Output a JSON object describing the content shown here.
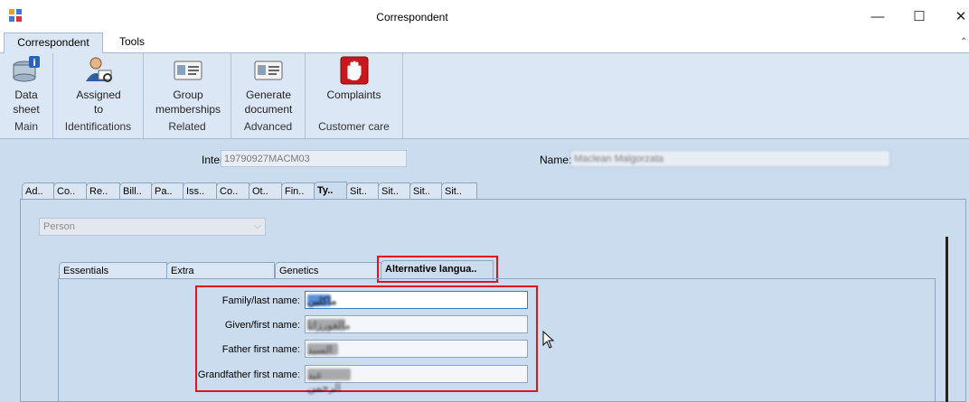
{
  "window": {
    "title": "Correspondent",
    "minimize_glyph": "—",
    "maximize_glyph": "☐",
    "close_glyph": "✕",
    "collapse_glyph": "⌃"
  },
  "ribbon": {
    "tabs": [
      {
        "label": "Correspondent",
        "selected": true
      },
      {
        "label": "Tools",
        "selected": false
      }
    ],
    "groups": [
      {
        "caption": "Main",
        "buttons": [
          {
            "label_lines": [
              "Data",
              "sheet"
            ],
            "icon": "database-info-icon"
          }
        ]
      },
      {
        "caption": "Identifications",
        "buttons": [
          {
            "label_lines": [
              "Assigned",
              "to"
            ],
            "icon": "person-id-search-icon"
          }
        ]
      },
      {
        "caption": "Related",
        "buttons": [
          {
            "label_lines": [
              "Group",
              "memberships"
            ],
            "icon": "id-card-icon"
          }
        ]
      },
      {
        "caption": "Advanced",
        "buttons": [
          {
            "label_lines": [
              "Generate",
              "document"
            ],
            "icon": "id-card-icon"
          }
        ]
      },
      {
        "caption": "Customer care",
        "buttons": [
          {
            "label_lines": [
              "Complaints"
            ],
            "icon": "stop-hand-icon"
          }
        ]
      }
    ]
  },
  "header_fields": {
    "internal_id": {
      "label": "Internal id:",
      "value": "19790927MACM03"
    },
    "name": {
      "label": "Name:",
      "value": "Maclean Malgorzata"
    }
  },
  "outer_tabs": [
    "Ad..",
    "Co..",
    "Re..",
    "Bill..",
    "Pa..",
    "Iss..",
    "Co..",
    "Ot..",
    "Fin..",
    "Ty..",
    "Sit..",
    "Sit..",
    "Sit..",
    "Sit.."
  ],
  "outer_tab_selected": "Ty..",
  "person_select": {
    "value": "Person",
    "chevron": "⌵"
  },
  "inner_tabs": [
    "Essentials",
    "Extra",
    "Genetics",
    "Alternative langua.."
  ],
  "inner_tab_selected": "Alternative langua..",
  "alt_language_fields": [
    {
      "label": "Family/last name:",
      "value": "ماكلين"
    },
    {
      "label": "Given/first name:",
      "value": "مالغورزاتا"
    },
    {
      "label": "Father first name:",
      "value": "السيد"
    },
    {
      "label": "Grandfather first name:",
      "value": "عبد الرحمن"
    }
  ],
  "colors": {
    "highlight": "#e0141e",
    "ribbon_bg": "#dce7f5",
    "content_bg": "#ccdcef"
  }
}
